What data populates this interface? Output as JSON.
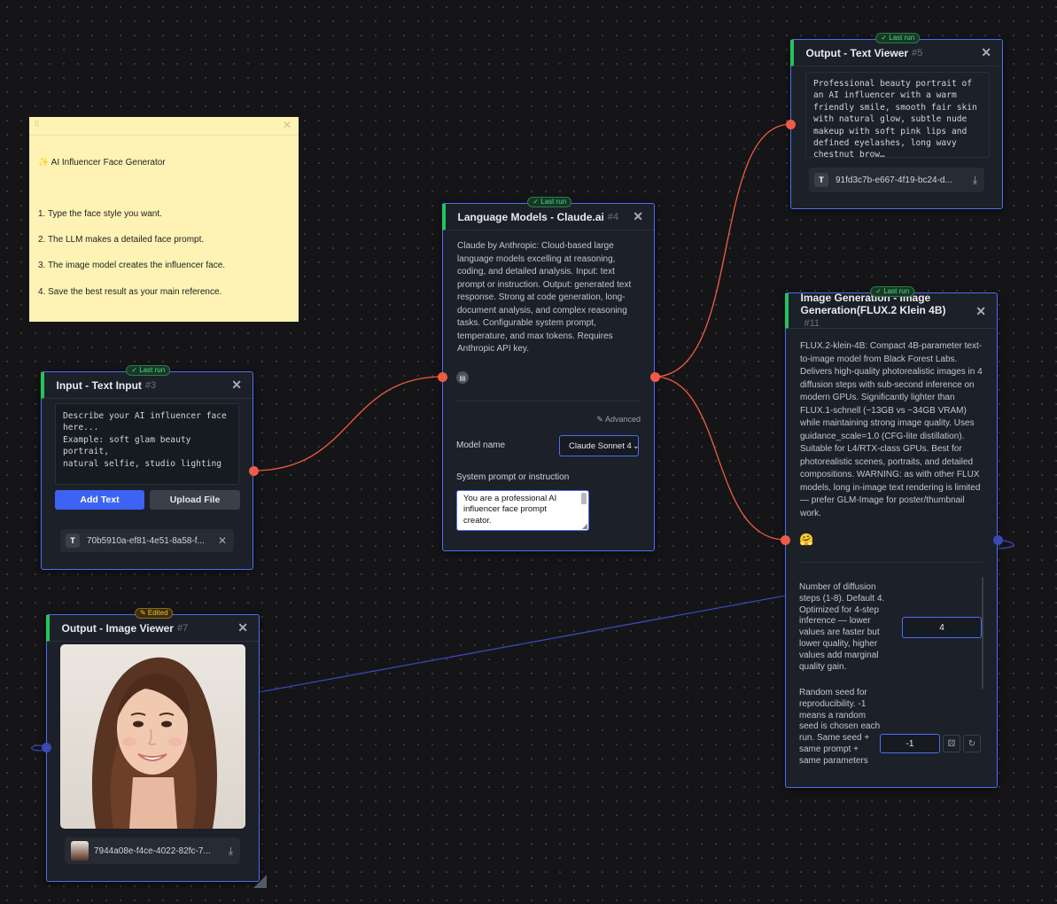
{
  "sticky": {
    "lines": [
      "✨ AI Influencer Face Generator",
      "",
      "1. Type the face style you want.",
      "2. The LLM makes a detailed face prompt.",
      "3. The image model creates the influencer face.",
      "4. Save the best result as your main reference."
    ]
  },
  "text_input": {
    "title": "Input - Text Input",
    "id": "#3",
    "badge": "✓ Last run",
    "textarea": "Describe your AI influencer face\nhere...\nExample: soft glam beauty portrait,\nnatural selfie, studio lighting",
    "add_button": "Add Text",
    "upload_button": "Upload File",
    "file_icon": "T",
    "file_name": "70b5910a-ef81-4e51-8a58-f..."
  },
  "llm": {
    "title": "Language Models - Claude.ai",
    "id": "#4",
    "badge": "✓ Last run",
    "description": "Claude by Anthropic: Cloud-based large language models excelling at reasoning, coding, and detailed analysis. Input: text prompt or instruction. Output: generated text response. Strong at code generation, long-document analysis, and complex reasoning tasks. Configurable system prompt, temperature, and max tokens. Requires Anthropic API key.",
    "advanced": "Advanced",
    "model_label": "Model name",
    "model_value": "Claude Sonnet 4",
    "system_label": "System prompt or instruction",
    "system_value": "You are a professional AI influencer face prompt creator."
  },
  "text_viewer": {
    "title": "Output - Text Viewer",
    "id": "#5",
    "badge": "✓ Last run",
    "text": "Professional beauty portrait of an AI influencer with a warm friendly smile, smooth fair skin with natural glow, subtle nude makeup with soft pink lips and defined eyelashes, long wavy chestnut brow…",
    "file_icon": "T",
    "file_name": "91fd3c7b-e667-4f19-bc24-d..."
  },
  "image_gen": {
    "title": "Image Generation - Image Generation(FLUX.2 Klein 4B)",
    "id": "#11",
    "badge": "✓ Last run",
    "description": "FLUX.2-klein-4B: Compact 4B-parameter text-to-image model from Black Forest Labs. Delivers high-quality photorealistic images in 4 diffusion steps with sub-second inference on modern GPUs. Significantly lighter than FLUX.1-schnell (~13GB vs ~34GB VRAM) while maintaining strong image quality. Uses guidance_scale=1.0 (CFG-lite distillation). Suitable for L4/RTX-class GPUs. Best for photorealistic scenes, portraits, and detailed compositions. WARNING: as with other FLUX models, long in-image text rendering is limited — prefer GLM-Image for poster/thumbnail work.",
    "emoji": "🤗",
    "steps_label": "Number of diffusion steps (1-8). Default 4. Optimized for 4-step inference — lower values are faster but lower quality, higher values add marginal quality gain.",
    "steps_value": "4",
    "seed_label": "Random seed for reproducibility. -1 means a random seed is chosen each run. Same seed + same prompt + same parameters",
    "seed_value": "-1"
  },
  "image_viewer": {
    "title": "Output - Image Viewer",
    "id": "#7",
    "badge": "✎ Edited",
    "file_name": "7944a08e-f4ce-4022-82fc-7..."
  },
  "colors": {
    "accent": "#4c6ef5",
    "wire_red": "#f05b45",
    "wire_blue": "#3b48b8",
    "success": "#22c55e",
    "sticky": "#fef3b5"
  }
}
